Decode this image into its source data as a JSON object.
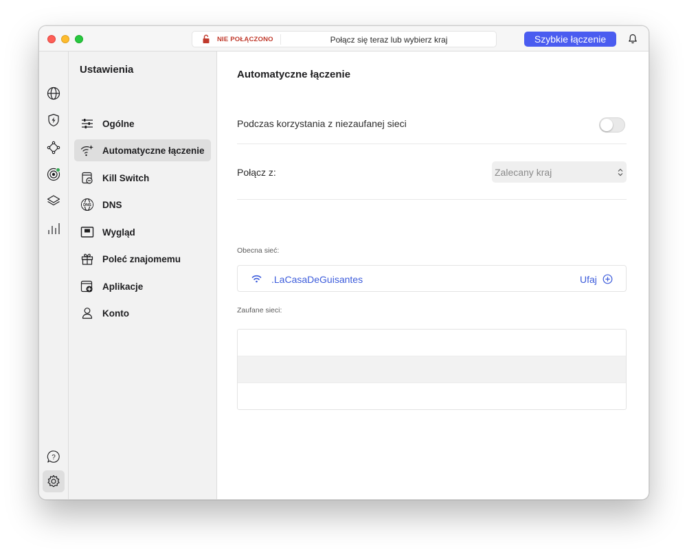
{
  "titlebar": {
    "status": "NIE POŁĄCZONO",
    "hint": "Połącz się teraz lub wybierz kraj",
    "quick_connect": "Szybkie łączenie",
    "status_color": "#c0392b",
    "accent_color": "#4a5cf0"
  },
  "rail": {
    "items": [
      {
        "icon": "globe-icon"
      },
      {
        "icon": "shield-bolt-icon"
      },
      {
        "icon": "mesh-network-icon"
      },
      {
        "icon": "target-icon"
      },
      {
        "icon": "layers-icon"
      },
      {
        "icon": "bar-chart-icon"
      }
    ],
    "bottom": [
      {
        "icon": "help-bubble-icon"
      },
      {
        "icon": "gear-icon"
      }
    ]
  },
  "sidebar": {
    "title": "Ustawienia",
    "items": [
      {
        "label": "Ogólne",
        "icon": "sliders-icon"
      },
      {
        "label": "Automatyczne łączenie",
        "icon": "wifi-sparkle-icon",
        "active": true
      },
      {
        "label": "Kill Switch",
        "icon": "kill-switch-icon"
      },
      {
        "label": "DNS",
        "icon": "dns-globe-icon"
      },
      {
        "label": "Wygląd",
        "icon": "appearance-icon"
      },
      {
        "label": "Poleć znajomemu",
        "icon": "gift-icon"
      },
      {
        "label": "Aplikacje",
        "icon": "apps-icon"
      },
      {
        "label": "Konto",
        "icon": "user-icon"
      }
    ]
  },
  "main": {
    "title": "Automatyczne łączenie",
    "untrusted_label": "Podczas korzystania z niezaufanej sieci",
    "untrusted_enabled": false,
    "connect_label": "Połącz z:",
    "connect_value": "Zalecany kraj",
    "current_network_label": "Obecna sieć:",
    "current_network": ".LaCasaDeGuisantes",
    "trust_label": "Ufaj",
    "trusted_label": "Zaufane sieci:",
    "trusted_networks": [
      "",
      "",
      ""
    ],
    "link_color": "#3b5bdb"
  }
}
